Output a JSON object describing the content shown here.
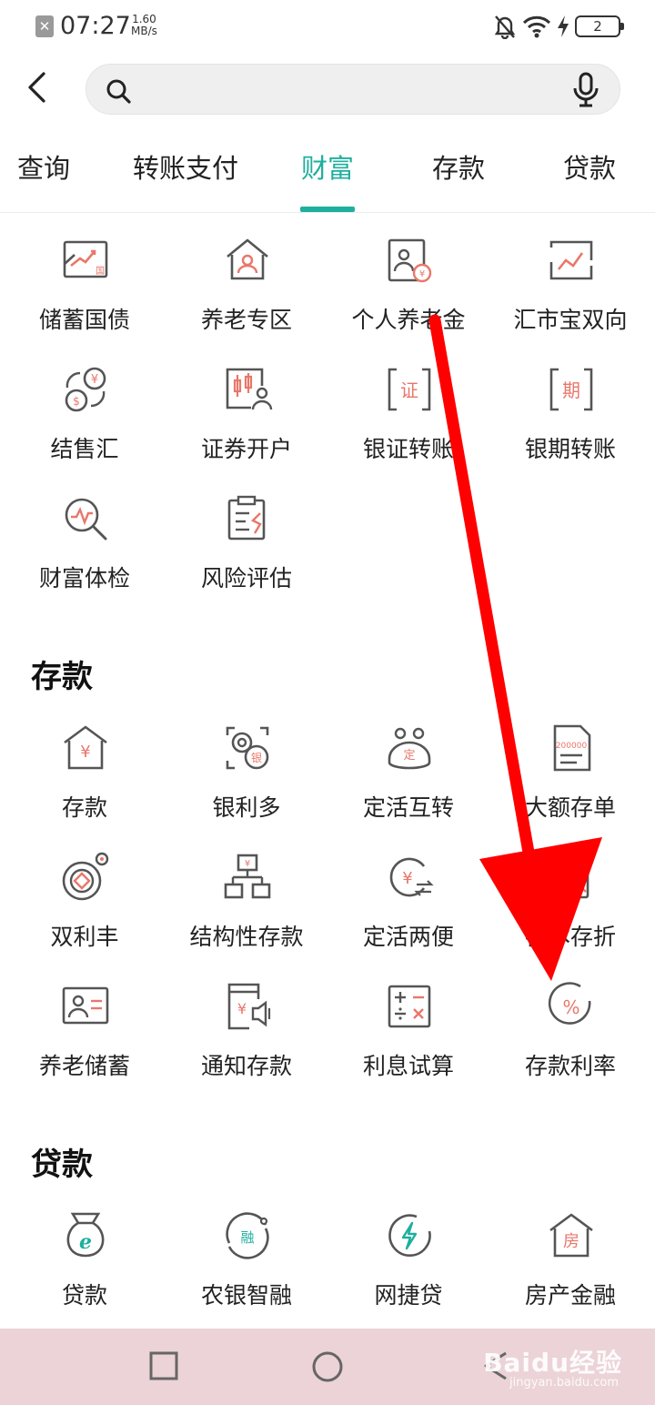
{
  "status_bar": {
    "time": "07:27",
    "speed_value": "1.60",
    "speed_unit": "MB/s",
    "battery": "2"
  },
  "search": {
    "value": "",
    "placeholder": ""
  },
  "tabs": [
    {
      "label": "查询",
      "active": false
    },
    {
      "label": "转账支付",
      "active": false
    },
    {
      "label": "财富",
      "active": true
    },
    {
      "label": "存款",
      "active": false
    },
    {
      "label": "贷款",
      "active": false
    }
  ],
  "wealth": {
    "items": [
      {
        "label": "储蓄国债",
        "icon": "bond-chart-icon"
      },
      {
        "label": "养老专区",
        "icon": "pension-house-icon"
      },
      {
        "label": "个人养老金",
        "icon": "pension-card-icon"
      },
      {
        "label": "汇市宝双向",
        "icon": "forex-chart-icon"
      },
      {
        "label": "结售汇",
        "icon": "currency-exchange-icon"
      },
      {
        "label": "证券开户",
        "icon": "securities-account-icon"
      },
      {
        "label": "银证转账",
        "icon": "bank-securities-transfer-icon"
      },
      {
        "label": "银期转账",
        "icon": "bank-futures-transfer-icon"
      },
      {
        "label": "财富体检",
        "icon": "wealth-checkup-icon"
      },
      {
        "label": "风险评估",
        "icon": "risk-assessment-icon"
      }
    ]
  },
  "deposit": {
    "title": "存款",
    "items": [
      {
        "label": "存款",
        "icon": "deposit-house-icon"
      },
      {
        "label": "银利多",
        "icon": "yinliduo-icon"
      },
      {
        "label": "定活互转",
        "icon": "fixed-demand-swap-icon"
      },
      {
        "label": "大额存单",
        "icon": "large-certificate-icon"
      },
      {
        "label": "双利丰",
        "icon": "shuanglifeng-icon"
      },
      {
        "label": "结构性存款",
        "icon": "structured-deposit-icon"
      },
      {
        "label": "定活两便",
        "icon": "fixed-demand-convenient-icon"
      },
      {
        "label": "存本存折",
        "icon": "passbook-icon"
      },
      {
        "label": "养老储蓄",
        "icon": "pension-savings-icon"
      },
      {
        "label": "通知存款",
        "icon": "notice-deposit-icon"
      },
      {
        "label": "利息试算",
        "icon": "interest-calculator-icon"
      },
      {
        "label": "存款利率",
        "icon": "deposit-rate-icon"
      }
    ]
  },
  "loan": {
    "title": "贷款",
    "items": [
      {
        "label": "贷款",
        "icon": "loan-bag-icon"
      },
      {
        "label": "农银智融",
        "icon": "nongyin-zhirong-icon"
      },
      {
        "label": "网捷贷",
        "icon": "wangjiedai-icon"
      },
      {
        "label": "房产金融",
        "icon": "house-finance-icon"
      }
    ]
  },
  "watermark": {
    "text": "Baidu经验",
    "sub": "jingyan.baidu.com"
  },
  "colors": {
    "accent": "#1eaf9e",
    "icon_stroke": "#555555",
    "icon_highlight": "#e9776a",
    "annotation_arrow": "#ff0000",
    "nav_bar": "#ebd3d7"
  }
}
